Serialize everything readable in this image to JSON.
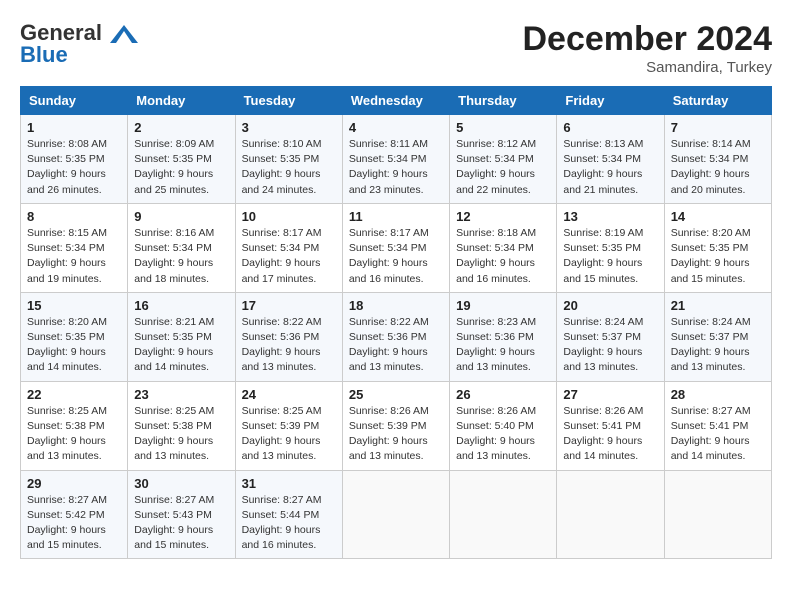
{
  "header": {
    "logo_line1": "General",
    "logo_line2": "Blue",
    "month": "December 2024",
    "location": "Samandira, Turkey"
  },
  "days_of_week": [
    "Sunday",
    "Monday",
    "Tuesday",
    "Wednesday",
    "Thursday",
    "Friday",
    "Saturday"
  ],
  "weeks": [
    [
      {
        "day": 1,
        "info": "Sunrise: 8:08 AM\nSunset: 5:35 PM\nDaylight: 9 hours\nand 26 minutes."
      },
      {
        "day": 2,
        "info": "Sunrise: 8:09 AM\nSunset: 5:35 PM\nDaylight: 9 hours\nand 25 minutes."
      },
      {
        "day": 3,
        "info": "Sunrise: 8:10 AM\nSunset: 5:35 PM\nDaylight: 9 hours\nand 24 minutes."
      },
      {
        "day": 4,
        "info": "Sunrise: 8:11 AM\nSunset: 5:34 PM\nDaylight: 9 hours\nand 23 minutes."
      },
      {
        "day": 5,
        "info": "Sunrise: 8:12 AM\nSunset: 5:34 PM\nDaylight: 9 hours\nand 22 minutes."
      },
      {
        "day": 6,
        "info": "Sunrise: 8:13 AM\nSunset: 5:34 PM\nDaylight: 9 hours\nand 21 minutes."
      },
      {
        "day": 7,
        "info": "Sunrise: 8:14 AM\nSunset: 5:34 PM\nDaylight: 9 hours\nand 20 minutes."
      }
    ],
    [
      {
        "day": 8,
        "info": "Sunrise: 8:15 AM\nSunset: 5:34 PM\nDaylight: 9 hours\nand 19 minutes."
      },
      {
        "day": 9,
        "info": "Sunrise: 8:16 AM\nSunset: 5:34 PM\nDaylight: 9 hours\nand 18 minutes."
      },
      {
        "day": 10,
        "info": "Sunrise: 8:17 AM\nSunset: 5:34 PM\nDaylight: 9 hours\nand 17 minutes."
      },
      {
        "day": 11,
        "info": "Sunrise: 8:17 AM\nSunset: 5:34 PM\nDaylight: 9 hours\nand 16 minutes."
      },
      {
        "day": 12,
        "info": "Sunrise: 8:18 AM\nSunset: 5:34 PM\nDaylight: 9 hours\nand 16 minutes."
      },
      {
        "day": 13,
        "info": "Sunrise: 8:19 AM\nSunset: 5:35 PM\nDaylight: 9 hours\nand 15 minutes."
      },
      {
        "day": 14,
        "info": "Sunrise: 8:20 AM\nSunset: 5:35 PM\nDaylight: 9 hours\nand 15 minutes."
      }
    ],
    [
      {
        "day": 15,
        "info": "Sunrise: 8:20 AM\nSunset: 5:35 PM\nDaylight: 9 hours\nand 14 minutes."
      },
      {
        "day": 16,
        "info": "Sunrise: 8:21 AM\nSunset: 5:35 PM\nDaylight: 9 hours\nand 14 minutes."
      },
      {
        "day": 17,
        "info": "Sunrise: 8:22 AM\nSunset: 5:36 PM\nDaylight: 9 hours\nand 13 minutes."
      },
      {
        "day": 18,
        "info": "Sunrise: 8:22 AM\nSunset: 5:36 PM\nDaylight: 9 hours\nand 13 minutes."
      },
      {
        "day": 19,
        "info": "Sunrise: 8:23 AM\nSunset: 5:36 PM\nDaylight: 9 hours\nand 13 minutes."
      },
      {
        "day": 20,
        "info": "Sunrise: 8:24 AM\nSunset: 5:37 PM\nDaylight: 9 hours\nand 13 minutes."
      },
      {
        "day": 21,
        "info": "Sunrise: 8:24 AM\nSunset: 5:37 PM\nDaylight: 9 hours\nand 13 minutes."
      }
    ],
    [
      {
        "day": 22,
        "info": "Sunrise: 8:25 AM\nSunset: 5:38 PM\nDaylight: 9 hours\nand 13 minutes."
      },
      {
        "day": 23,
        "info": "Sunrise: 8:25 AM\nSunset: 5:38 PM\nDaylight: 9 hours\nand 13 minutes."
      },
      {
        "day": 24,
        "info": "Sunrise: 8:25 AM\nSunset: 5:39 PM\nDaylight: 9 hours\nand 13 minutes."
      },
      {
        "day": 25,
        "info": "Sunrise: 8:26 AM\nSunset: 5:39 PM\nDaylight: 9 hours\nand 13 minutes."
      },
      {
        "day": 26,
        "info": "Sunrise: 8:26 AM\nSunset: 5:40 PM\nDaylight: 9 hours\nand 13 minutes."
      },
      {
        "day": 27,
        "info": "Sunrise: 8:26 AM\nSunset: 5:41 PM\nDaylight: 9 hours\nand 14 minutes."
      },
      {
        "day": 28,
        "info": "Sunrise: 8:27 AM\nSunset: 5:41 PM\nDaylight: 9 hours\nand 14 minutes."
      }
    ],
    [
      {
        "day": 29,
        "info": "Sunrise: 8:27 AM\nSunset: 5:42 PM\nDaylight: 9 hours\nand 15 minutes."
      },
      {
        "day": 30,
        "info": "Sunrise: 8:27 AM\nSunset: 5:43 PM\nDaylight: 9 hours\nand 15 minutes."
      },
      {
        "day": 31,
        "info": "Sunrise: 8:27 AM\nSunset: 5:44 PM\nDaylight: 9 hours\nand 16 minutes."
      },
      null,
      null,
      null,
      null
    ]
  ]
}
